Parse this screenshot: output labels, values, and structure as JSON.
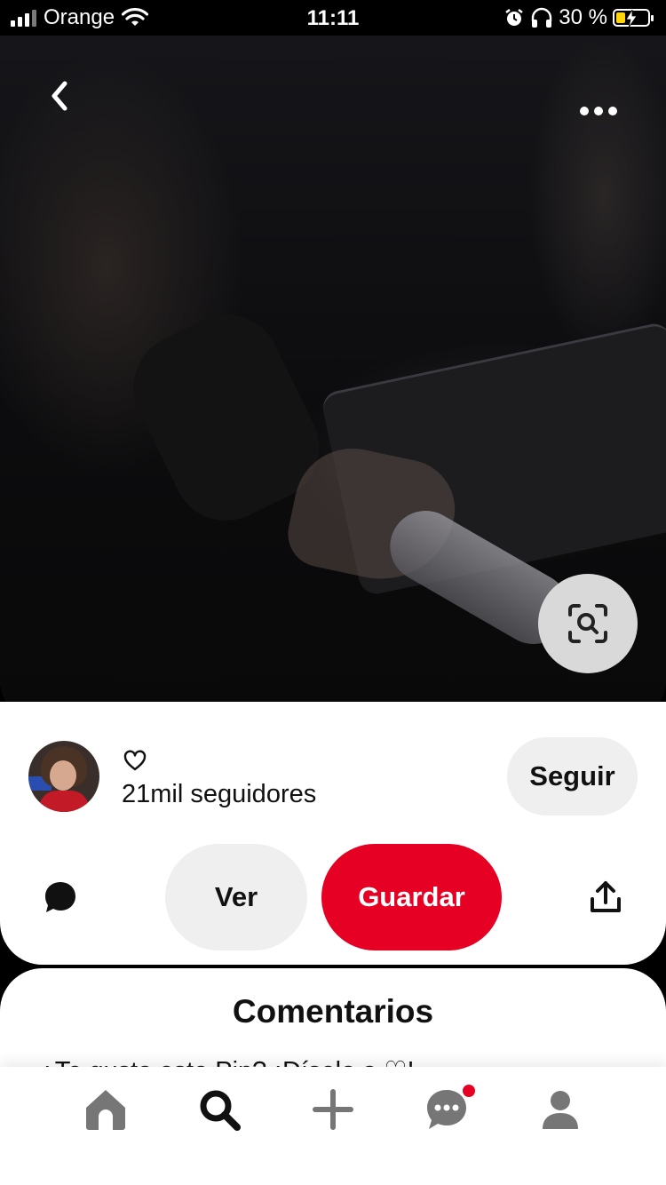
{
  "status_bar": {
    "carrier": "Orange",
    "time": "11:11",
    "battery_percent": "30 %",
    "battery_level": 0.3
  },
  "pin": {
    "back_icon": "chevron-left-icon",
    "back_glyph": "‹",
    "more_icon": "more-horizontal-icon",
    "more_glyph": "•••",
    "lens_icon": "visual-search-icon"
  },
  "creator": {
    "followers": "21mil seguidores",
    "follow_label": "Seguir"
  },
  "actions": {
    "view_label": "Ver",
    "save_label": "Guardar",
    "save_color": "#e60023"
  },
  "comments": {
    "title": "Comentarios",
    "prompt": "¿Te gusta este Pin? ¡Díselo a ♡!"
  },
  "tab_bar": {
    "items": [
      {
        "icon": "home-icon"
      },
      {
        "icon": "search-icon",
        "active": true
      },
      {
        "icon": "add-icon"
      },
      {
        "icon": "messages-icon",
        "has_notification": true
      },
      {
        "icon": "profile-icon"
      }
    ]
  }
}
